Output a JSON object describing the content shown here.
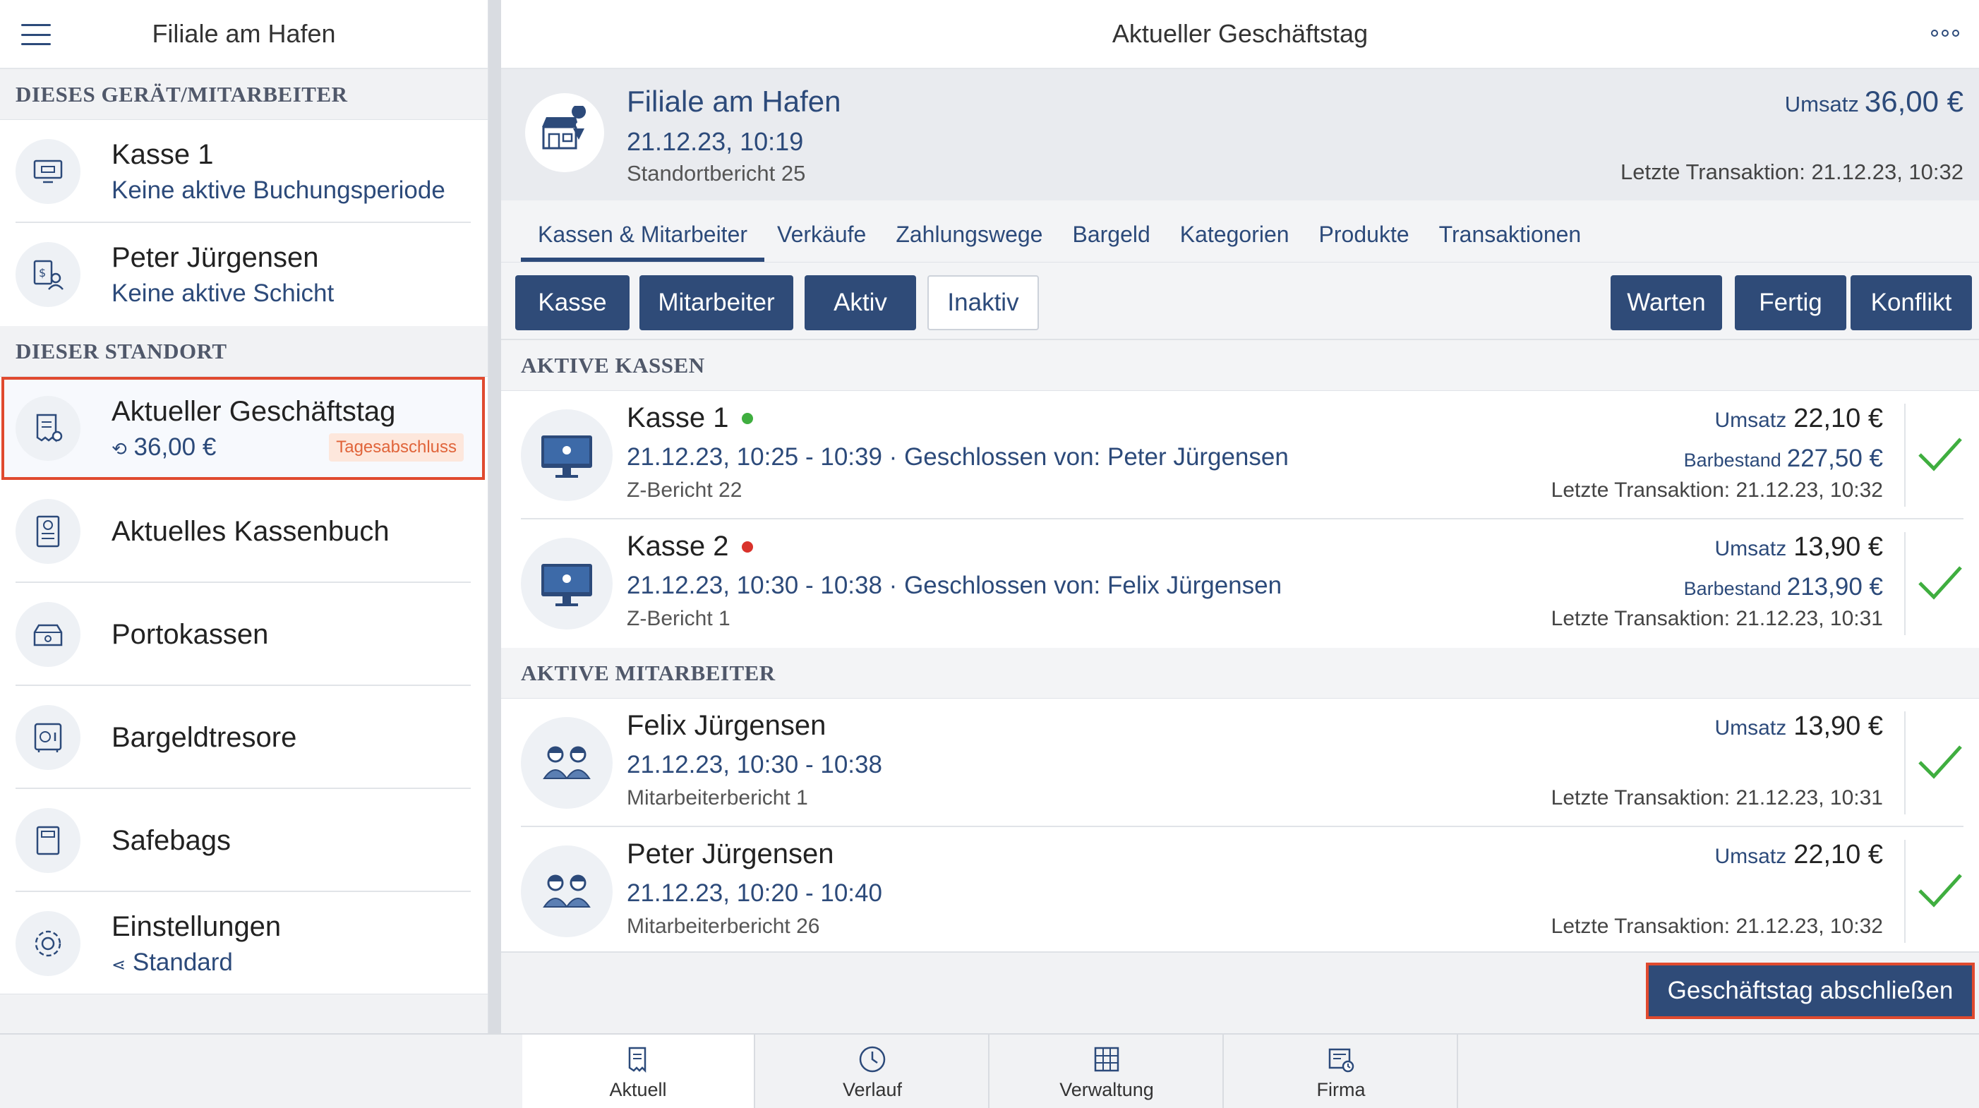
{
  "sidebar": {
    "header_title": "Filiale am Hafen",
    "section_device": "DIESES GERÄT/MITARBEITER",
    "section_location": "DIESER STANDORT",
    "items": [
      {
        "title": "Kasse 1",
        "subtitle": "Keine aktive Buchungsperiode",
        "icon": "register-icon"
      },
      {
        "title": "Peter Jürgensen",
        "subtitle": "Keine aktive Schicht",
        "icon": "employee-shift-icon"
      },
      {
        "title": "Aktueller Geschäftstag",
        "subtitle": "36,00 €",
        "badge": "Tagesabschluss",
        "icon": "receipt-icon"
      },
      {
        "title": "Aktuelles Kassenbuch",
        "icon": "cashbook-icon"
      },
      {
        "title": "Portokassen",
        "icon": "petty-cash-icon"
      },
      {
        "title": "Bargeldtresore",
        "icon": "safe-icon"
      },
      {
        "title": "Safebags",
        "icon": "safebag-icon"
      },
      {
        "title": "Einstellungen",
        "subtitle": "Standard",
        "icon": "gear-icon"
      }
    ]
  },
  "main": {
    "title": "Aktueller Geschäftstag",
    "location": {
      "name": "Filiale am Hafen",
      "date": "21.12.23, 10:19",
      "report": "Standortbericht 25",
      "umsatz_label": "Umsatz",
      "umsatz_value": "36,00 €",
      "last_transaction": "Letzte Transaktion: 21.12.23, 10:32"
    },
    "tabs": [
      "Kassen & Mitarbeiter",
      "Verkäufe",
      "Zahlungswege",
      "Bargeld",
      "Kategorien",
      "Produkte",
      "Transaktionen"
    ],
    "filters": {
      "left": [
        "Kasse",
        "Mitarbeiter",
        "Aktiv",
        "Inaktiv"
      ],
      "right": [
        "Warten",
        "Fertig",
        "Konflikt"
      ]
    },
    "section_registers": "AKTIVE KASSEN",
    "registers": [
      {
        "name": "Kasse 1",
        "status_color": "#3fae3f",
        "line2": "21.12.23, 10:25 - 10:39 · Geschlossen von: Peter Jürgensen",
        "line3": "Z-Bericht 22",
        "umsatz_label": "Umsatz",
        "umsatz": "22,10 €",
        "bar_label": "Barbestand",
        "bar": "227,50 €",
        "last": "Letzte Transaktion: 21.12.23, 10:32"
      },
      {
        "name": "Kasse 2",
        "status_color": "#d9322b",
        "line2": "21.12.23, 10:30 - 10:38 · Geschlossen von: Felix Jürgensen",
        "line3": "Z-Bericht 1",
        "umsatz_label": "Umsatz",
        "umsatz": "13,90 €",
        "bar_label": "Barbestand",
        "bar": "213,90 €",
        "last": "Letzte Transaktion: 21.12.23, 10:31"
      }
    ],
    "section_employees": "AKTIVE MITARBEITER",
    "employees": [
      {
        "name": "Felix Jürgensen",
        "line2": "21.12.23, 10:30 - 10:38",
        "line3": "Mitarbeiterbericht 1",
        "umsatz_label": "Umsatz",
        "umsatz": "13,90 €",
        "last": "Letzte Transaktion: 21.12.23, 10:31"
      },
      {
        "name": "Peter Jürgensen",
        "line2": "21.12.23, 10:20 - 10:40",
        "line3": "Mitarbeiterbericht 26",
        "umsatz_label": "Umsatz",
        "umsatz": "22,10 €",
        "last": "Letzte Transaktion: 21.12.23, 10:32"
      }
    ],
    "close_day_button": "Geschäftstag abschließen"
  },
  "bottom_nav": [
    {
      "label": "Aktuell",
      "icon": "receipt-icon"
    },
    {
      "label": "Verlauf",
      "icon": "clock-icon"
    },
    {
      "label": "Verwaltung",
      "icon": "grid-icon"
    },
    {
      "label": "Firma",
      "icon": "company-icon"
    }
  ],
  "colors": {
    "primary": "#2f4b78",
    "highlight": "#e04a2f",
    "success": "#3fae3f",
    "danger": "#d9322b"
  }
}
